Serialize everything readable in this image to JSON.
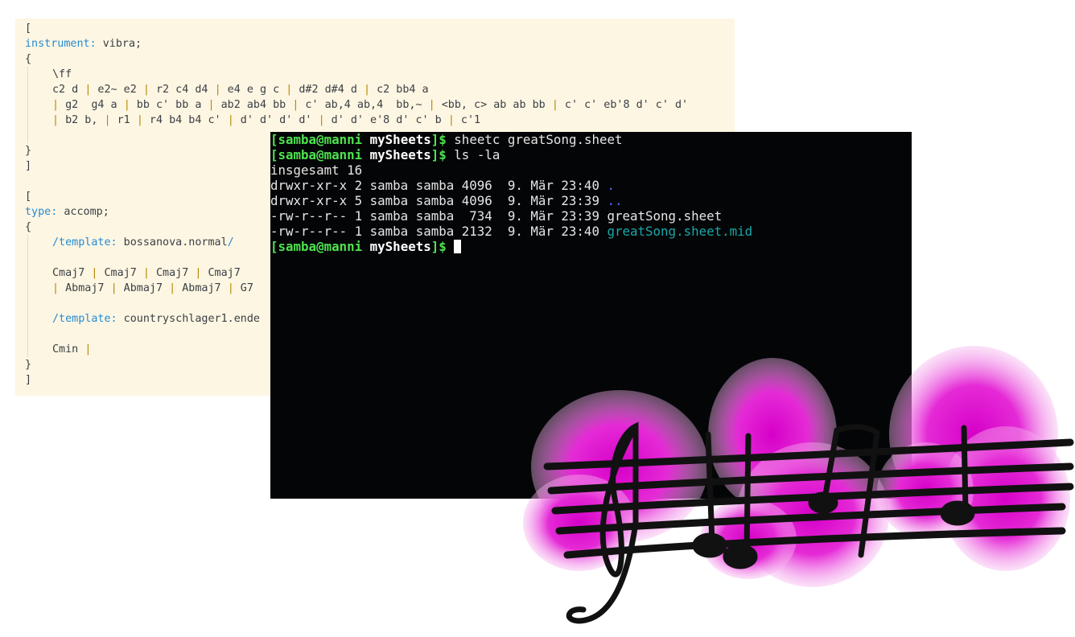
{
  "code": {
    "block1": {
      "open": "[",
      "instrument_key": "instrument:",
      "instrument_value": " vibra;",
      "brace_open": "{",
      "dynamics": "\\ff",
      "line1": [
        "c2 d ",
        " e2~ e2 ",
        " r2 c4 d4 ",
        " e4 e g c ",
        " d#2 d#4 d ",
        " c2 bb4 a"
      ],
      "line2": [
        "",
        " g2  g4 a ",
        " bb c' bb a ",
        " ab2 ab4 bb ",
        " c' ab,4 ab,4  bb,~ ",
        " <bb, c> ab ab bb ",
        " c' c' eb'8 d' c' d'"
      ],
      "line3": [
        "",
        " b2 b, ",
        " r1 ",
        " r4 b4 b4 c' ",
        " d' d' d' d' ",
        " d' d' e'8 d' c' b ",
        " c'1"
      ],
      "brace_close": "}",
      "close": "]"
    },
    "block2": {
      "open": "[",
      "type_key": "type:",
      "type_value": " accomp;",
      "brace_open": "{",
      "template1_key": "/template:",
      "template1_value": " bossanova.normal",
      "template1_slash": "/",
      "chords1": [
        "Cmaj7 ",
        " Cmaj7 ",
        " Cmaj7 ",
        " Cmaj7 "
      ],
      "chords2": [
        "",
        " Abmaj7 ",
        " Abmaj7 ",
        " Abmaj7 ",
        " G7"
      ],
      "template2_key": "/template:",
      "template2_value": " countryschlager1.ende",
      "chords3": [
        "Cmin "
      ],
      "brace_close": "}",
      "close": "]"
    }
  },
  "terminal": {
    "prompt_user": "[samba@manni",
    "prompt_dir": " mySheets",
    "prompt_end": "]$",
    "cmd1": " sheetc greatSong.sheet",
    "cmd2": " ls -la",
    "total": "insgesamt 16",
    "entries": [
      {
        "meta": "drwxr-xr-x 2 samba samba 4096  9. Mär 23:40 ",
        "name": "."
      },
      {
        "meta": "drwxr-xr-x 5 samba samba 4096  9. Mär 23:39 ",
        "name": ".."
      },
      {
        "meta": "-rw-r--r-- 1 samba samba  734  9. Mär 23:39 ",
        "name": "greatSong.sheet"
      },
      {
        "meta": "-rw-r--r-- 1 samba samba 2132  9. Mär 23:40 ",
        "name": "greatSong.sheet.mid"
      }
    ]
  },
  "colors": {
    "code_background": "#fdf6e3",
    "keyword_blue": "#268bd2",
    "bar_yellow": "#b58900",
    "terminal_background": "#040507",
    "prompt_green": "#4ee34e",
    "directory_blue": "#5c6cff",
    "midi_file_cyan": "#19a8a8",
    "splash_magenta": "#e020d0"
  },
  "artwork": {
    "icon": "music-notes-watercolor-icon"
  }
}
